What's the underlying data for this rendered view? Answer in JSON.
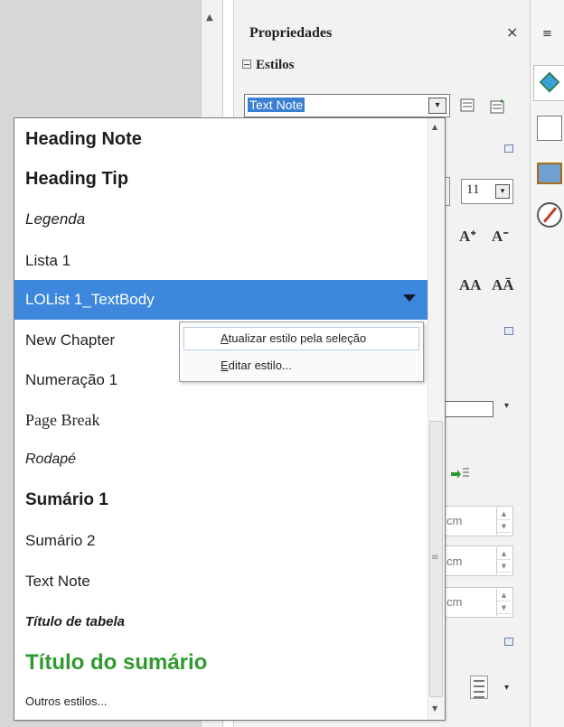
{
  "sidebar": {
    "title": "Propriedades",
    "close_glyph": "×",
    "styles_section": {
      "header": "Estilos",
      "current_style": "Text Note",
      "dropdown_glyph": "▾",
      "new_style_icon": "new-style-from-selection-icon",
      "update_style_icon": "update-style-icon"
    },
    "character_section": {
      "font_size": "11",
      "grow_font_glyph": "Aᐩ",
      "shrink_font_glyph": "Aᐨ",
      "spacing_inc_glyph": "AA",
      "spacing_dec_glyph": "AĀ"
    },
    "paragraph_section": {
      "indent_units": [
        "cm",
        "cm",
        "cm"
      ],
      "spin_up": "▲",
      "spin_down": "▼"
    }
  },
  "tabbar": {
    "menu_glyph": "≡",
    "tabs": [
      "properties-icon",
      "styles-icon",
      "gallery-icon",
      "navigator-icon"
    ]
  },
  "dropdown": {
    "items": [
      {
        "label": "Heading Note"
      },
      {
        "label": "Heading Tip"
      },
      {
        "label": "Legenda"
      },
      {
        "label": "Lista 1"
      },
      {
        "label": "LOList 1_TextBody",
        "selected": true
      },
      {
        "label": "New Chapter"
      },
      {
        "label": "Numeração 1"
      },
      {
        "label": "Page Break"
      },
      {
        "label": "Rodapé"
      },
      {
        "label": "Sumário 1"
      },
      {
        "label": "Sumário 2"
      },
      {
        "label": "Text Note"
      },
      {
        "label": "Título de tabela"
      },
      {
        "label": "Título do sumário"
      },
      {
        "label": "Outros estilos..."
      }
    ],
    "scroll_up_glyph": "▲",
    "scroll_down_glyph": "▼",
    "thumb_grip": "≡"
  },
  "context_menu": {
    "update": {
      "mnemonic": "A",
      "rest": "tualizar estilo pela seleção"
    },
    "edit": {
      "mnemonic": "E",
      "rest": "ditar estilo..."
    }
  },
  "colors": {
    "selection": "#3d88dc",
    "green_heading": "#2e9a2e"
  }
}
